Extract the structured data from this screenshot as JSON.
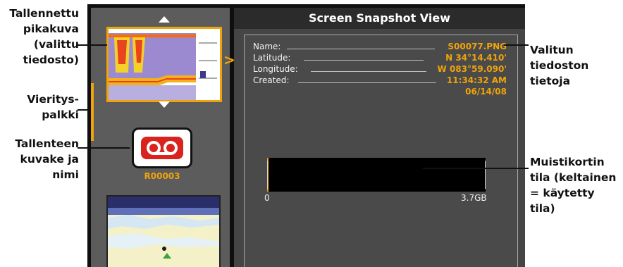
{
  "callouts": {
    "saved_screenshot": [
      "Tallennettu",
      "pikakuva",
      "(valittu",
      "tiedosto)"
    ],
    "scrollbar": [
      "Vieritys-",
      "palkki"
    ],
    "recording": [
      "Tallenteen",
      "kuvake ja",
      "nimi"
    ],
    "file_info": [
      "Valitun",
      "tiedoston",
      "tietoja"
    ],
    "memory_card": [
      "Muistikortin",
      "tila (keltainen",
      "= käytetty tila)"
    ]
  },
  "screen": {
    "title": "Screen Snapshot View",
    "selected_arrow": ">",
    "recording_name": "R00003"
  },
  "details": {
    "name_label": "Name:",
    "name_value": "S00077.PNG",
    "latitude_label": "Latitude:",
    "latitude_value": "N 34°14.410'",
    "longitude_label": "Longitude:",
    "longitude_value": "W 083°59.090'",
    "created_label": "Created:",
    "created_time": "11:34:32 AM",
    "created_date": "06/14/08"
  },
  "storage": {
    "min_label": "0",
    "max_label": "3.7GB",
    "used_fraction": 0.005
  },
  "colors": {
    "accent": "#f0a30a",
    "recording_red": "#d9231d"
  }
}
